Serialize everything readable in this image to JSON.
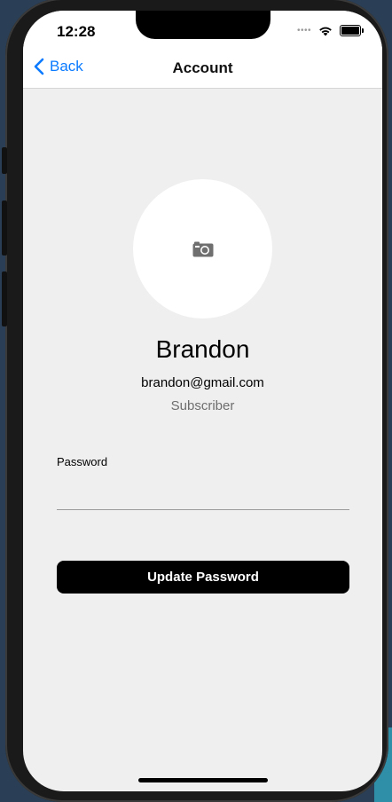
{
  "status_bar": {
    "time": "12:28",
    "signal_icon": "signal-dots-icon",
    "wifi_icon": "wifi-icon",
    "battery_icon": "battery-icon"
  },
  "nav": {
    "back_label": "Back",
    "title": "Account",
    "accent_color": "#0a7aff"
  },
  "profile": {
    "avatar_icon": "camera-icon",
    "name": "Brandon",
    "email": "brandon@gmail.com",
    "role": "Subscriber"
  },
  "password": {
    "label": "Password",
    "value": "",
    "placeholder": ""
  },
  "actions": {
    "update_label": "Update Password"
  }
}
